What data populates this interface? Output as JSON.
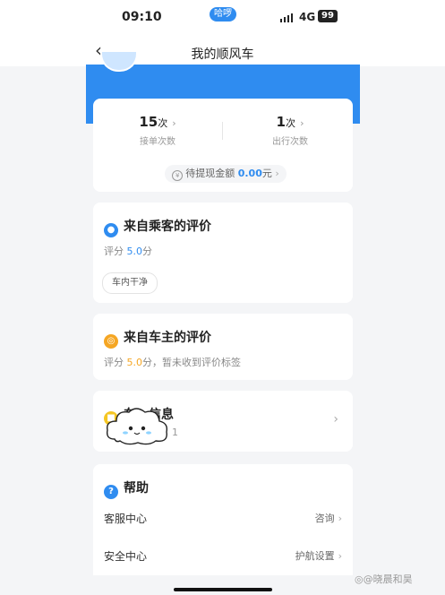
{
  "status": {
    "time": "09:10",
    "pill": "哈啰",
    "network": "4G",
    "battery": "99"
  },
  "nav": {
    "back": "‹",
    "title": "我的顺风车"
  },
  "stats": {
    "accept": {
      "count": "15",
      "unit": "次",
      "label": "接单次数"
    },
    "trips": {
      "count": "1",
      "unit": "次",
      "label": "出行次数"
    },
    "wallet_label": "待提现金额",
    "wallet_amount": "0.00",
    "wallet_unit": "元"
  },
  "passenger": {
    "title": "来自乘客的评价",
    "rating_label": "评分",
    "rating_value": "5.0",
    "rating_unit": "分",
    "tag": "车内干净"
  },
  "driver": {
    "title": "来自车主的评价",
    "rating_label": "评分",
    "rating_value": "5.0",
    "rating_suffix": "分，暂未收到评价标签"
  },
  "vehicle": {
    "title_a": "车",
    "title_b": "信息",
    "fragment": "1"
  },
  "help": {
    "title": "帮助",
    "rows": [
      {
        "label": "客服中心",
        "action": "咨询"
      },
      {
        "label": "安全中心",
        "action": "护航设置"
      }
    ]
  },
  "watermark": "◎@晓晨和昊",
  "colors": {
    "brand": "#2f8cf0"
  }
}
